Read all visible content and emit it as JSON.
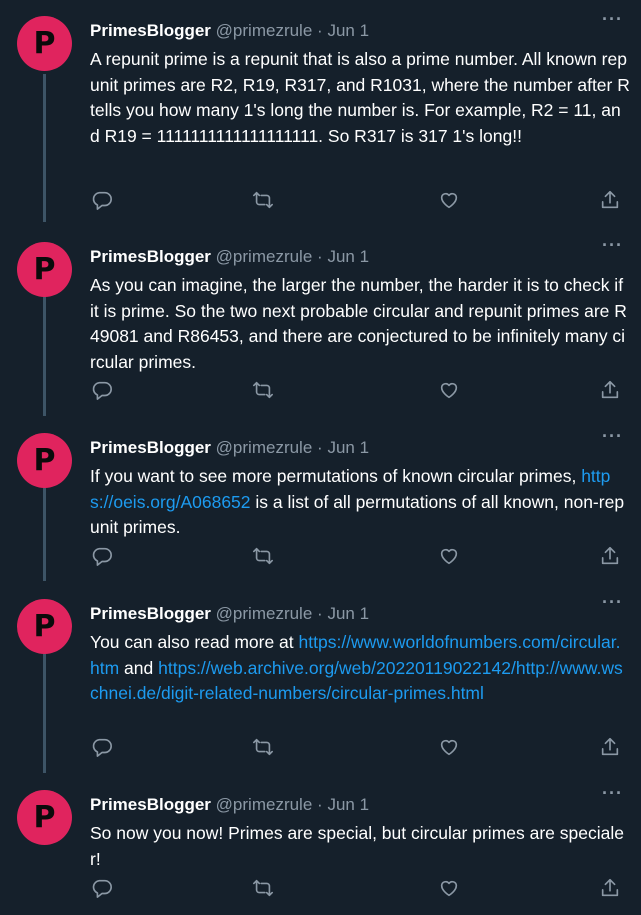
{
  "author": {
    "name": "PrimesBlogger",
    "handle": "@primezrule",
    "avatar_letter": "P",
    "avatar_color": "#e0245e"
  },
  "separator": "·",
  "colors": {
    "background": "#15202b",
    "link": "#1d9bf0",
    "muted": "#8b98a5",
    "thread_line": "#3d5466"
  },
  "tweets": [
    {
      "date": "Jun 1",
      "more": "···",
      "text": "A repunit prime is a repunit that is also a prime number. All known repunit primes are R2, R19, R317, and R1031, where the number after R tells you how many 1's long the number is. For example, R2 = 11, and R19 = 1111111111111111111. So R317 is 317 1's long!!"
    },
    {
      "date": "Jun 1",
      "more": "···",
      "text": "As you can imagine, the larger the number, the harder it is to check if it is prime. So the two next probable circular and repunit primes are R49081 and R86453, and there are conjectured to be infinitely many circular primes."
    },
    {
      "date": "Jun 1",
      "more": "···",
      "text_before": "If you want to see more permutations of known circular primes, ",
      "link": "https://oeis.org/A068652",
      "text_after": " is a list of all permutations of all known, non-repunit primes."
    },
    {
      "date": "Jun 1",
      "more": "···",
      "text_before": "You can also read more at ",
      "link1": "https://www.worldofnumbers.com/circular.htm",
      "text_mid": " and ",
      "link2": "https://web.archive.org/web/20220119022142/http://www.wschnei.de/digit-related-numbers/circular-primes.html"
    },
    {
      "date": "Jun 1",
      "more": "···",
      "text": "So now you now! Primes are special, but circular primes are specialer!"
    }
  ],
  "action_icons": [
    "reply-icon",
    "retweet-icon",
    "like-icon",
    "share-icon"
  ]
}
